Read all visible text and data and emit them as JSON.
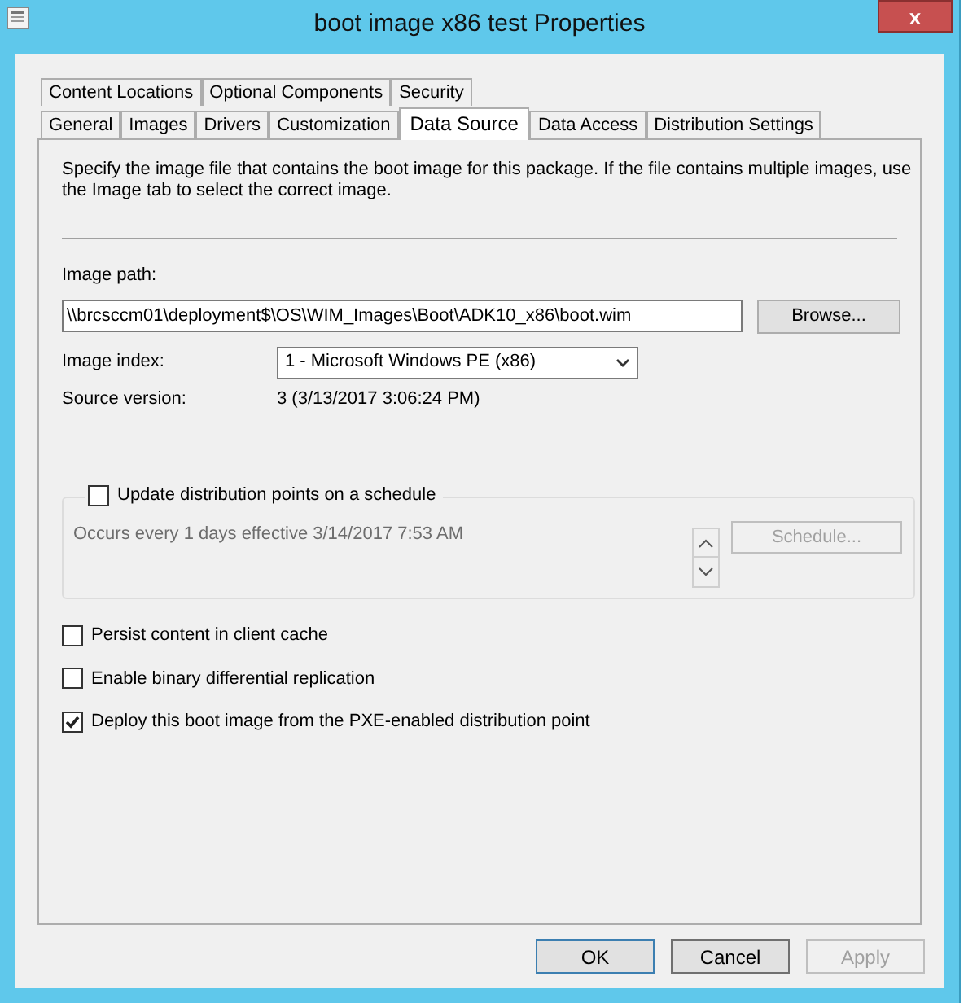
{
  "window": {
    "title": "boot image x86 test Properties",
    "close": "x"
  },
  "tab_rows": [
    [
      {
        "label": "Content Locations",
        "selected": false
      },
      {
        "label": "Optional Components",
        "selected": false
      },
      {
        "label": "Security",
        "selected": false
      }
    ],
    [
      {
        "label": "General",
        "selected": false
      },
      {
        "label": "Images",
        "selected": false
      },
      {
        "label": "Drivers",
        "selected": false
      },
      {
        "label": "Customization",
        "selected": false
      },
      {
        "label": "Data Source",
        "selected": true
      },
      {
        "label": "Data Access",
        "selected": false
      },
      {
        "label": "Distribution Settings",
        "selected": false
      }
    ]
  ],
  "description": "Specify the image file that contains the boot image for this package. If the file contains multiple images, use the Image tab to select the correct image.",
  "image_path": {
    "label": "Image path:",
    "value": "\\\\brcsccm01\\deployment$\\OS\\WIM_Images\\Boot\\ADK10_x86\\boot.wim",
    "button": "Browse..."
  },
  "image_index": {
    "label": "Image index:",
    "value": "1 - Microsoft Windows PE (x86)"
  },
  "source_version": {
    "label": "Source version:",
    "value": "3 (3/13/2017 3:06:24 PM)"
  },
  "schedule_group": {
    "label": "Update distribution points on a schedule",
    "checked": false,
    "text": "Occurs every 1 days effective 3/14/2017 7:53 AM",
    "button": "Schedule...",
    "disabled": true
  },
  "options": [
    {
      "label": "Persist content in client cache",
      "checked": false
    },
    {
      "label": "Enable binary differential replication",
      "checked": false
    },
    {
      "label": "Deploy this boot image from the PXE-enabled distribution point",
      "checked": true
    }
  ],
  "buttons": [
    {
      "label": "OK",
      "disabled": false,
      "default": true
    },
    {
      "label": "Cancel",
      "disabled": false,
      "default": false
    },
    {
      "label": "Apply",
      "disabled": true,
      "default": false
    }
  ]
}
